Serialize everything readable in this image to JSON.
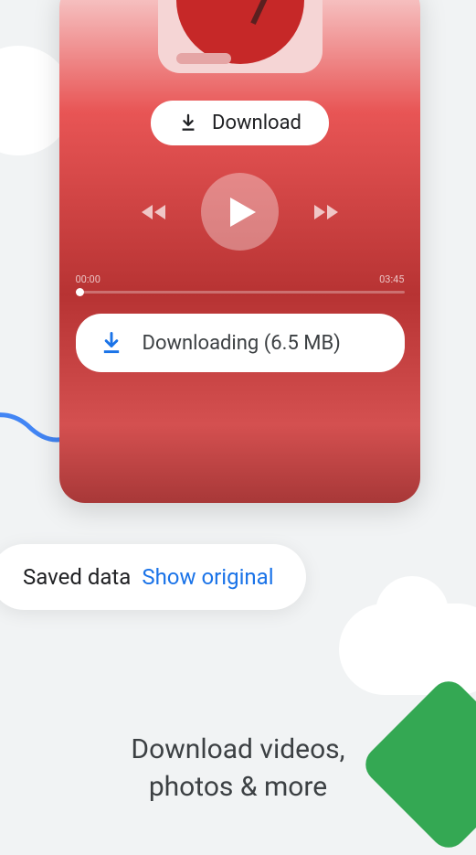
{
  "download_button": {
    "label": "Download"
  },
  "player": {
    "current_time": "00:00",
    "total_time": "03:45"
  },
  "downloading": {
    "label": "Downloading (6.5 MB)"
  },
  "saved_data": {
    "label": "Saved data",
    "show_original": "Show original"
  },
  "promo": {
    "line1": "Download videos,",
    "line2": "photos & more"
  },
  "colors": {
    "accent_blue": "#1a73e8",
    "accent_green": "#34a853"
  }
}
